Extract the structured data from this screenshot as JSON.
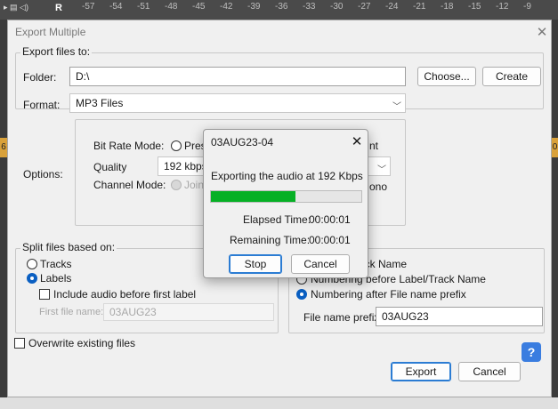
{
  "background": {
    "ruler_left_label": "R",
    "ruler_ticks": [
      "-57",
      "-54",
      "-51",
      "-48",
      "-45",
      "-42",
      "-39",
      "-36",
      "-33",
      "-30",
      "-27",
      "-24",
      "-21",
      "-18",
      "-15",
      "-12",
      "-9"
    ],
    "left_tag": "6",
    "right_tag": "0"
  },
  "window": {
    "title": "Export Multiple",
    "close_glyph": "✕",
    "export_files_to": {
      "legend": "Export files to:",
      "folder_label": "Folder:",
      "folder_value": "D:\\",
      "choose_button": "Choose...",
      "create_button": "Create",
      "format_label": "Format:",
      "format_value": "MP3 Files"
    },
    "options": {
      "label": "Options:",
      "bit_rate_mode_label": "Bit Rate Mode:",
      "bit_rate_mode_preset": "Prese",
      "bit_rate_mode_constant_tail": "nt",
      "quality_label": "Quality",
      "quality_value": "192 kbps",
      "channel_mode_label": "Channel Mode:",
      "channel_mode_joint": "Joint St",
      "channel_mode_mono_tail": "ono"
    },
    "split": {
      "legend": "Split files based on:",
      "tracks": "Tracks",
      "labels": "Labels",
      "include_audio": "Include audio before first label",
      "first_file_name_label": "First file name:",
      "first_file_name_value": "03AUG23"
    },
    "naming": {
      "using_label_track_name": "ack Name",
      "numbering_before": "Numbering before Label/Track Name",
      "numbering_after": "Numbering after File name prefix",
      "prefix_label": "File name prefix:",
      "prefix_value": "03AUG23"
    },
    "overwrite": "Overwrite existing files",
    "export_button": "Export",
    "cancel_button": "Cancel",
    "help_glyph": "?"
  },
  "progress_dialog": {
    "title": "03AUG23-04",
    "close_glyph": "✕",
    "message": "Exporting the audio at 192 Kbps",
    "progress_fraction": 0.56,
    "elapsed_label": "Elapsed Time:",
    "elapsed_value": "00:00:01",
    "remaining_label": "Remaining Time:",
    "remaining_value": "00:00:01",
    "stop_button": "Stop",
    "cancel_button": "Cancel"
  },
  "colors": {
    "progress_fill": "#06b025",
    "accent_blue": "#0a5fc2",
    "help_button": "#3a7de0"
  }
}
